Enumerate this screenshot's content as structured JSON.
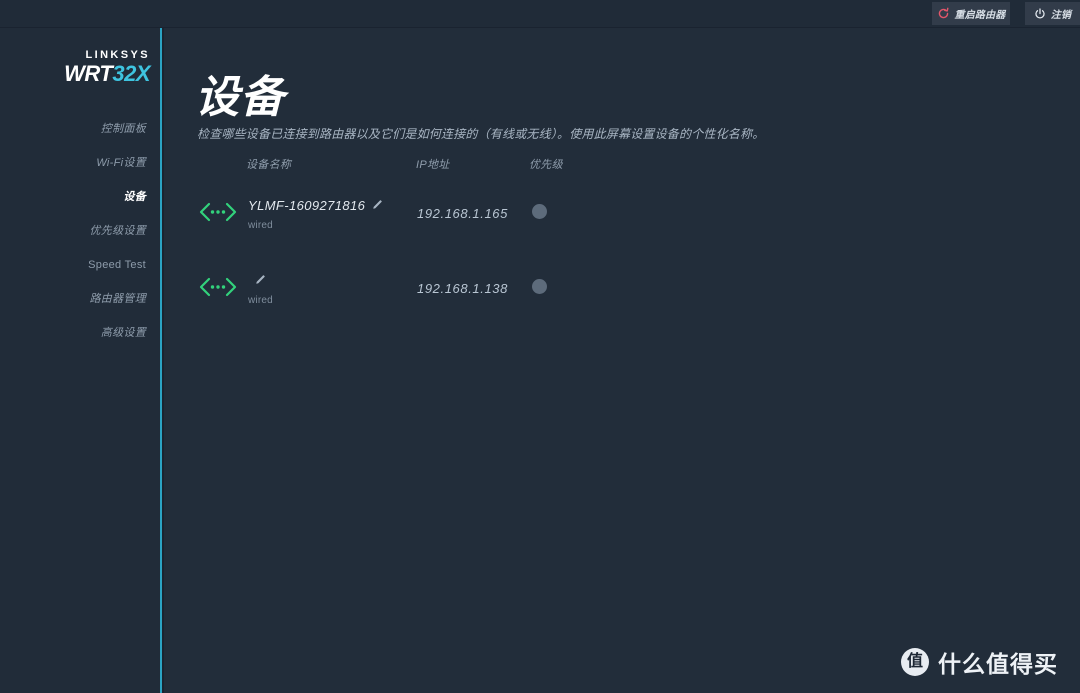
{
  "topbar": {
    "reboot_label": "重启路由器",
    "reboot_icon": "reboot-arrow-icon",
    "logout_label": "注销",
    "logout_icon": "power-icon"
  },
  "sidebar": {
    "logo": {
      "brand": "LINKSYS",
      "model_main": "WRT",
      "model_accent": "32X",
      "accent_color": "#3ec4e0"
    },
    "divider_color": "#2ba4c4",
    "items": [
      {
        "label": "控制面板",
        "active": false,
        "latin": false
      },
      {
        "label": "Wi-Fi设置",
        "active": false,
        "latin": false
      },
      {
        "label": "设备",
        "active": true,
        "latin": false
      },
      {
        "label": "优先级设置",
        "active": false,
        "latin": false
      },
      {
        "label": "Speed Test",
        "active": false,
        "latin": true
      },
      {
        "label": "路由器管理",
        "active": false,
        "latin": false
      },
      {
        "label": "高级设置",
        "active": false,
        "latin": false
      }
    ]
  },
  "main": {
    "title": "设备",
    "description": "检查哪些设备已连接到路由器以及它们是如何连接的（有线或无线）。使用此屏幕设置设备的个性化名称。",
    "table": {
      "headers": {
        "name": "设备名称",
        "ip": "IP地址",
        "priority": "优先级"
      },
      "rows": [
        {
          "connection_icon": "ethernet-chevrons-icon",
          "name": "YLMF-1609271816",
          "edit_icon": "pencil-icon",
          "connection": "wired",
          "ip": "192.168.1.165",
          "priority_color": "#5d6b7b"
        },
        {
          "connection_icon": "ethernet-chevrons-icon",
          "name": "",
          "edit_icon": "pencil-icon",
          "connection": "wired",
          "ip": "192.168.1.138",
          "priority_color": "#5d6b7b"
        }
      ]
    }
  },
  "watermark": {
    "badge": "值",
    "text": "什么值得买"
  }
}
